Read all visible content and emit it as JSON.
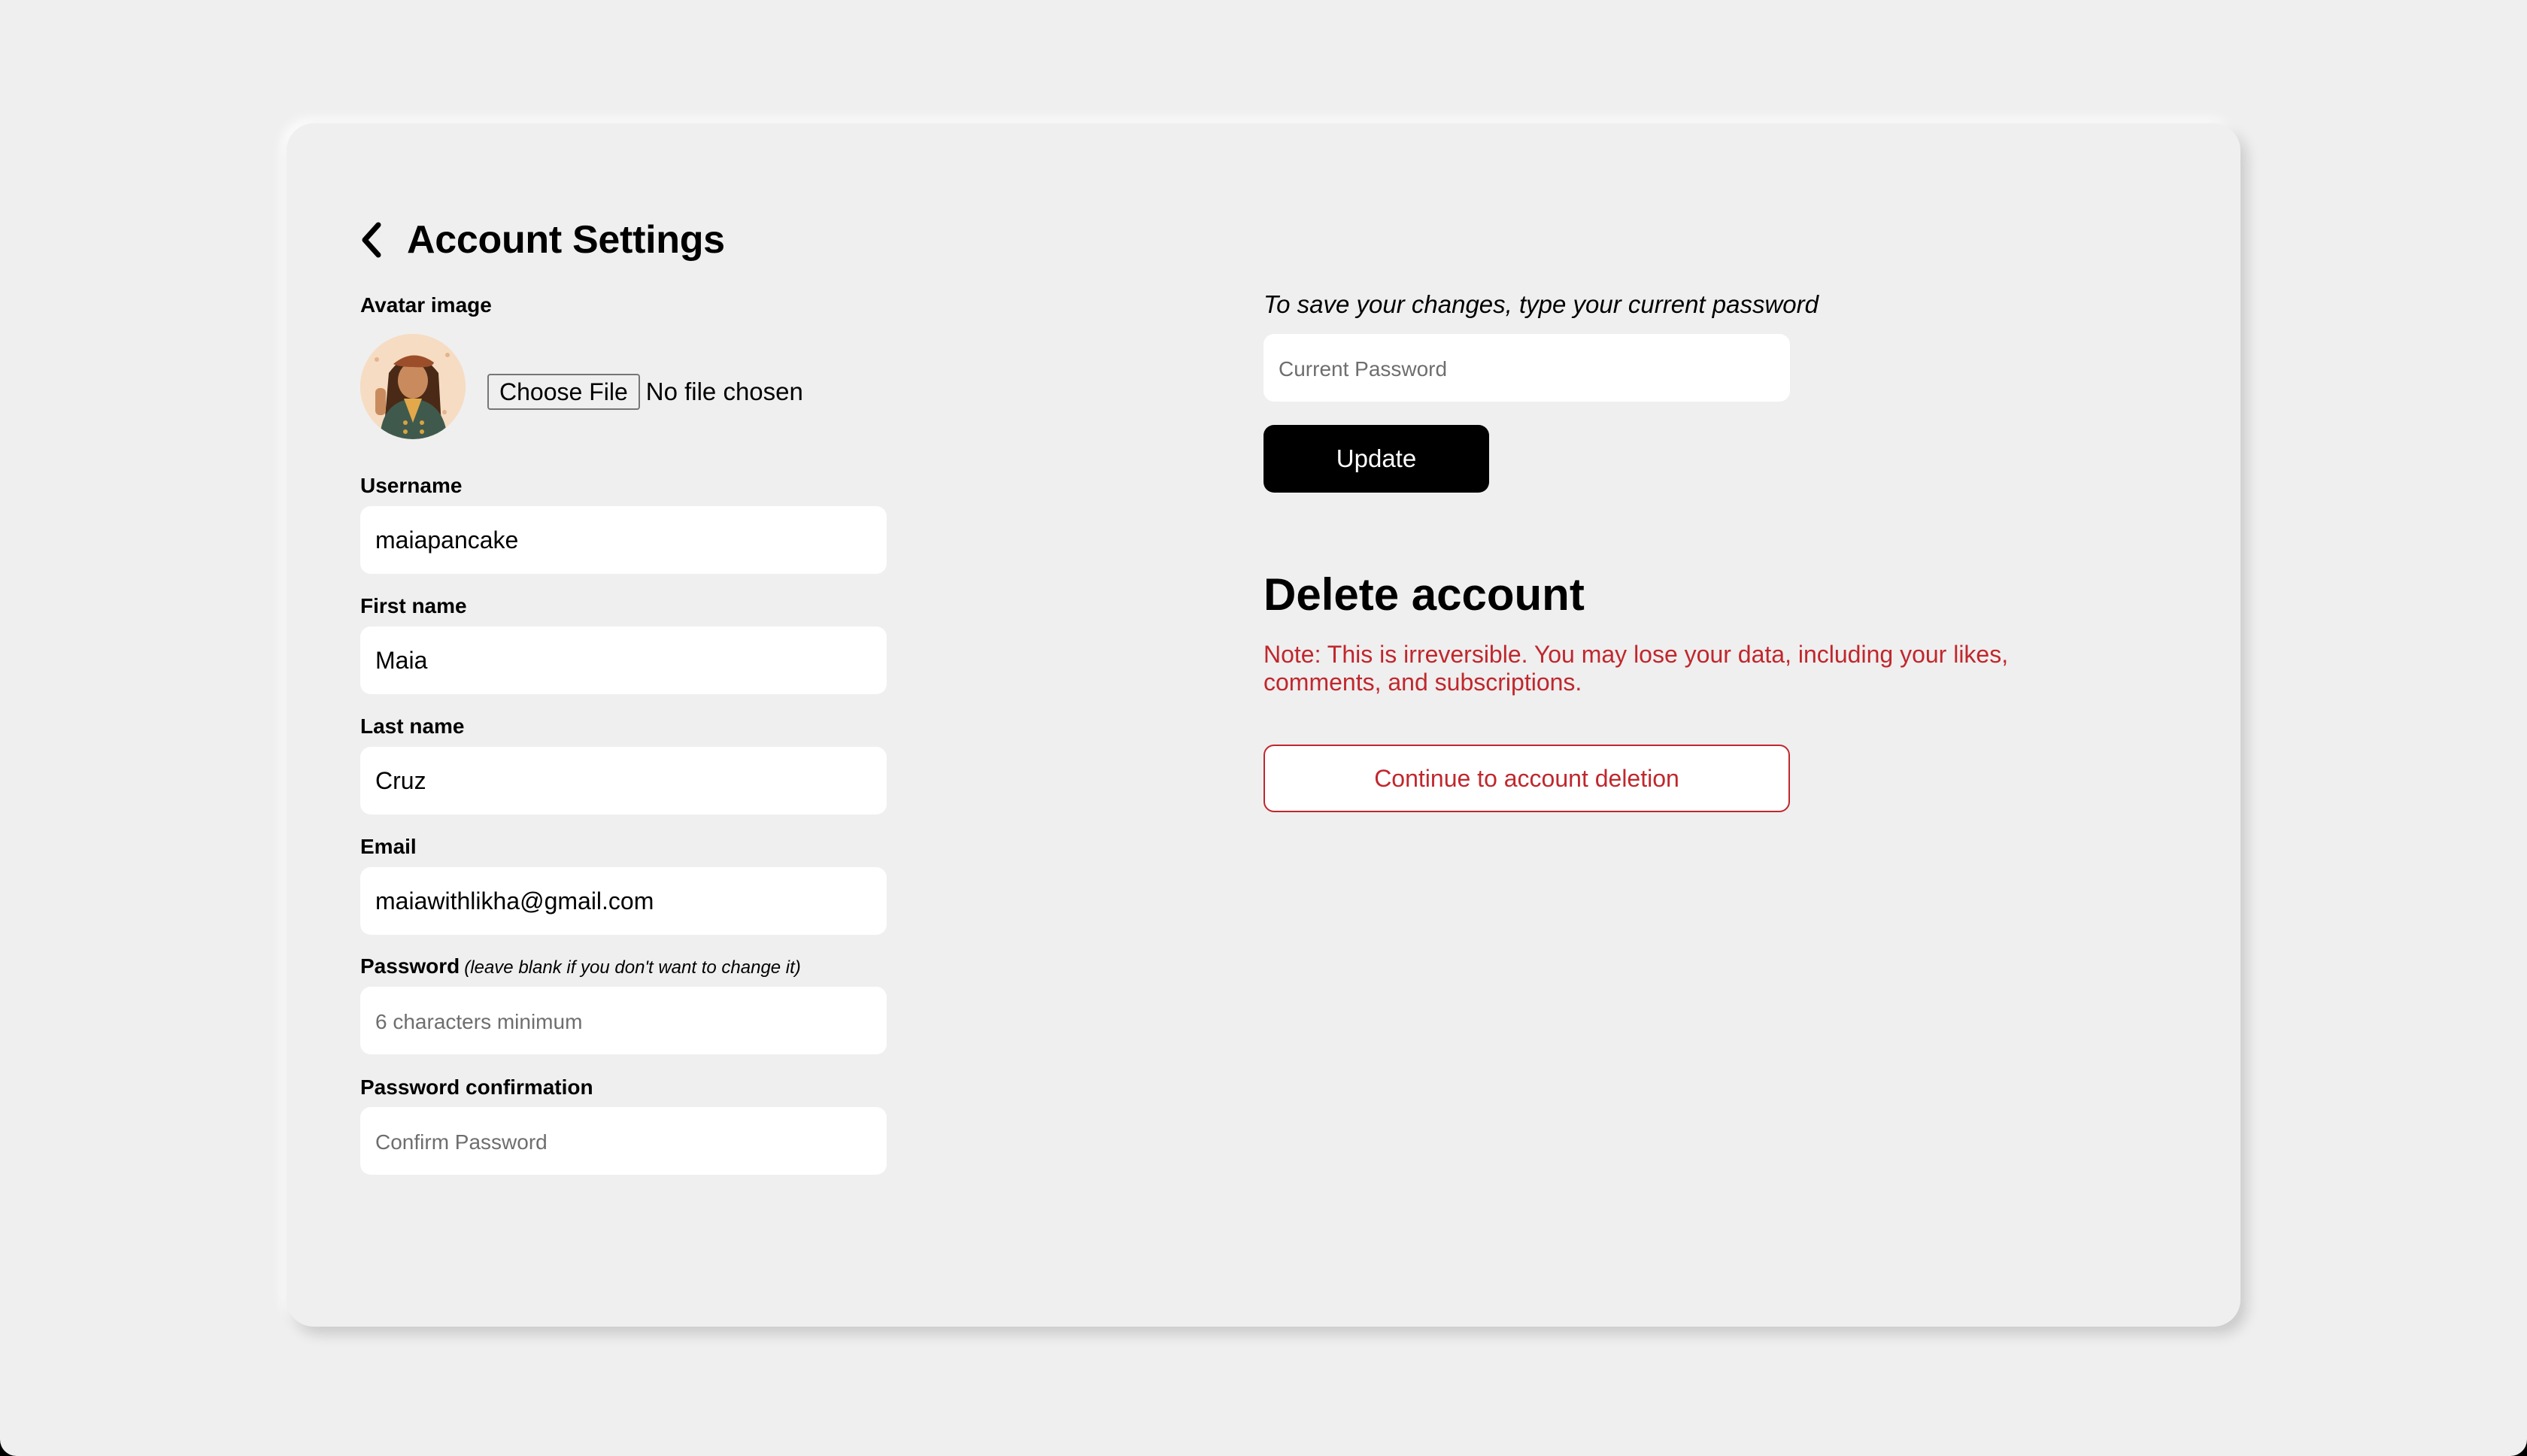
{
  "header": {
    "title": "Account Settings",
    "back_icon": "chevron-left-icon"
  },
  "avatar": {
    "label": "Avatar image",
    "choose_file_label": "Choose File",
    "file_status": "No file chosen"
  },
  "form": {
    "username": {
      "label": "Username",
      "value": "maiapancake"
    },
    "first_name": {
      "label": "First name",
      "value": "Maia"
    },
    "last_name": {
      "label": "Last name",
      "value": "Cruz"
    },
    "email": {
      "label": "Email",
      "value": "maiawithlikha@gmail.com"
    },
    "password": {
      "label": "Password",
      "hint": "(leave blank if you don't want to change it)",
      "placeholder": "6 characters minimum"
    },
    "password_confirmation": {
      "label": "Password confirmation",
      "placeholder": "Confirm Password"
    }
  },
  "save": {
    "hint": "To save your changes, type your current password",
    "current_password_placeholder": "Current Password",
    "update_label": "Update"
  },
  "delete_account": {
    "heading": "Delete account",
    "note": "Note: This is irreversible. You may lose your data, including your likes, comments, and subscriptions.",
    "button_label": "Continue to account deletion"
  },
  "colors": {
    "background": "#efefef",
    "danger": "#c0272d",
    "primary_button": "#000000"
  }
}
